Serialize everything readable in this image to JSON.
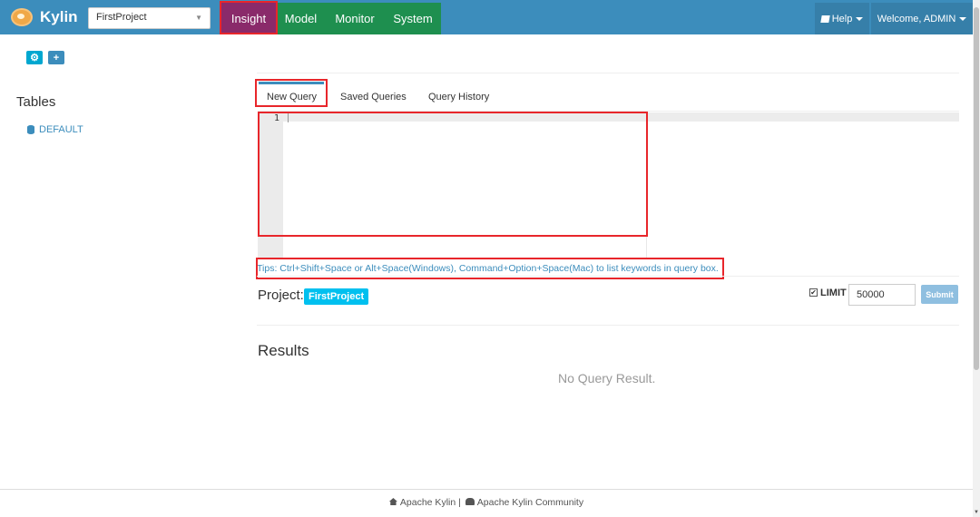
{
  "app": {
    "name": "Kylin"
  },
  "navbar": {
    "project_select": "FirstProject",
    "items": [
      {
        "label": "Insight",
        "active": true
      },
      {
        "label": "Model"
      },
      {
        "label": "Monitor"
      },
      {
        "label": "System"
      }
    ],
    "help_label": "Help",
    "welcome_label": "Welcome, ADMIN"
  },
  "sidebar": {
    "title": "Tables",
    "databases": [
      {
        "label": "DEFAULT"
      }
    ]
  },
  "query": {
    "tabs": [
      {
        "label": "New Query",
        "active": true
      },
      {
        "label": "Saved Queries"
      },
      {
        "label": "Query History"
      }
    ],
    "editor": {
      "line_numbers": [
        "1"
      ],
      "content": ""
    },
    "tips": "Tips: Ctrl+Shift+Space or Alt+Space(Windows), Command+Option+Space(Mac) to list keywords in query box.",
    "project_label": "Project:",
    "project_name": "FirstProject",
    "limit_label": "LIMIT",
    "limit_checked": true,
    "limit_value": "50000",
    "submit_label": "Submit"
  },
  "results": {
    "title": "Results",
    "empty_message": "No Query Result."
  },
  "footer": {
    "link1": "Apache Kylin",
    "separator": "|",
    "link2": "Apache Kylin Community"
  },
  "colors": {
    "navbar": "#3c8dbc",
    "insight_active": "#8a2a6a",
    "nav_green": "#1e8f4f",
    "highlight": "#e8262b",
    "badge": "#00c0ef"
  }
}
